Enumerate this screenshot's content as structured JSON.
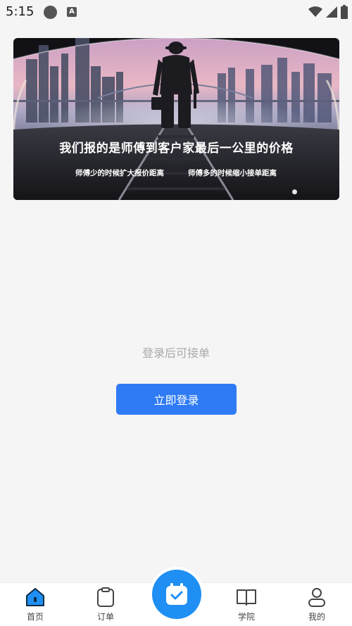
{
  "status_bar": {
    "time": "5:15",
    "icons": [
      "notification-dot-icon",
      "text-a-icon",
      "wifi-icon",
      "signal-icon",
      "battery-icon"
    ]
  },
  "banner": {
    "title": "我们报的是师傅到客户家最后一公里的价格",
    "subtitle_left": "师傅少的时候扩大报价距离",
    "subtitle_right": "师傅多的时候缩小接单距离",
    "page_indicator": "1"
  },
  "main": {
    "hint": "登录后可接单",
    "login_button": "立即登录"
  },
  "tabbar": {
    "items": [
      {
        "label": "首页",
        "icon": "home-icon",
        "active": true
      },
      {
        "label": "订单",
        "icon": "clipboard-icon",
        "active": false
      },
      {
        "label": "",
        "icon": "calendar-check-icon",
        "active": false
      },
      {
        "label": "学院",
        "icon": "book-icon",
        "active": false
      },
      {
        "label": "我的",
        "icon": "user-icon",
        "active": false
      }
    ]
  },
  "colors": {
    "accent": "#2f7bf5",
    "center_button": "#1f8ff3",
    "background": "#f5f5f5"
  }
}
